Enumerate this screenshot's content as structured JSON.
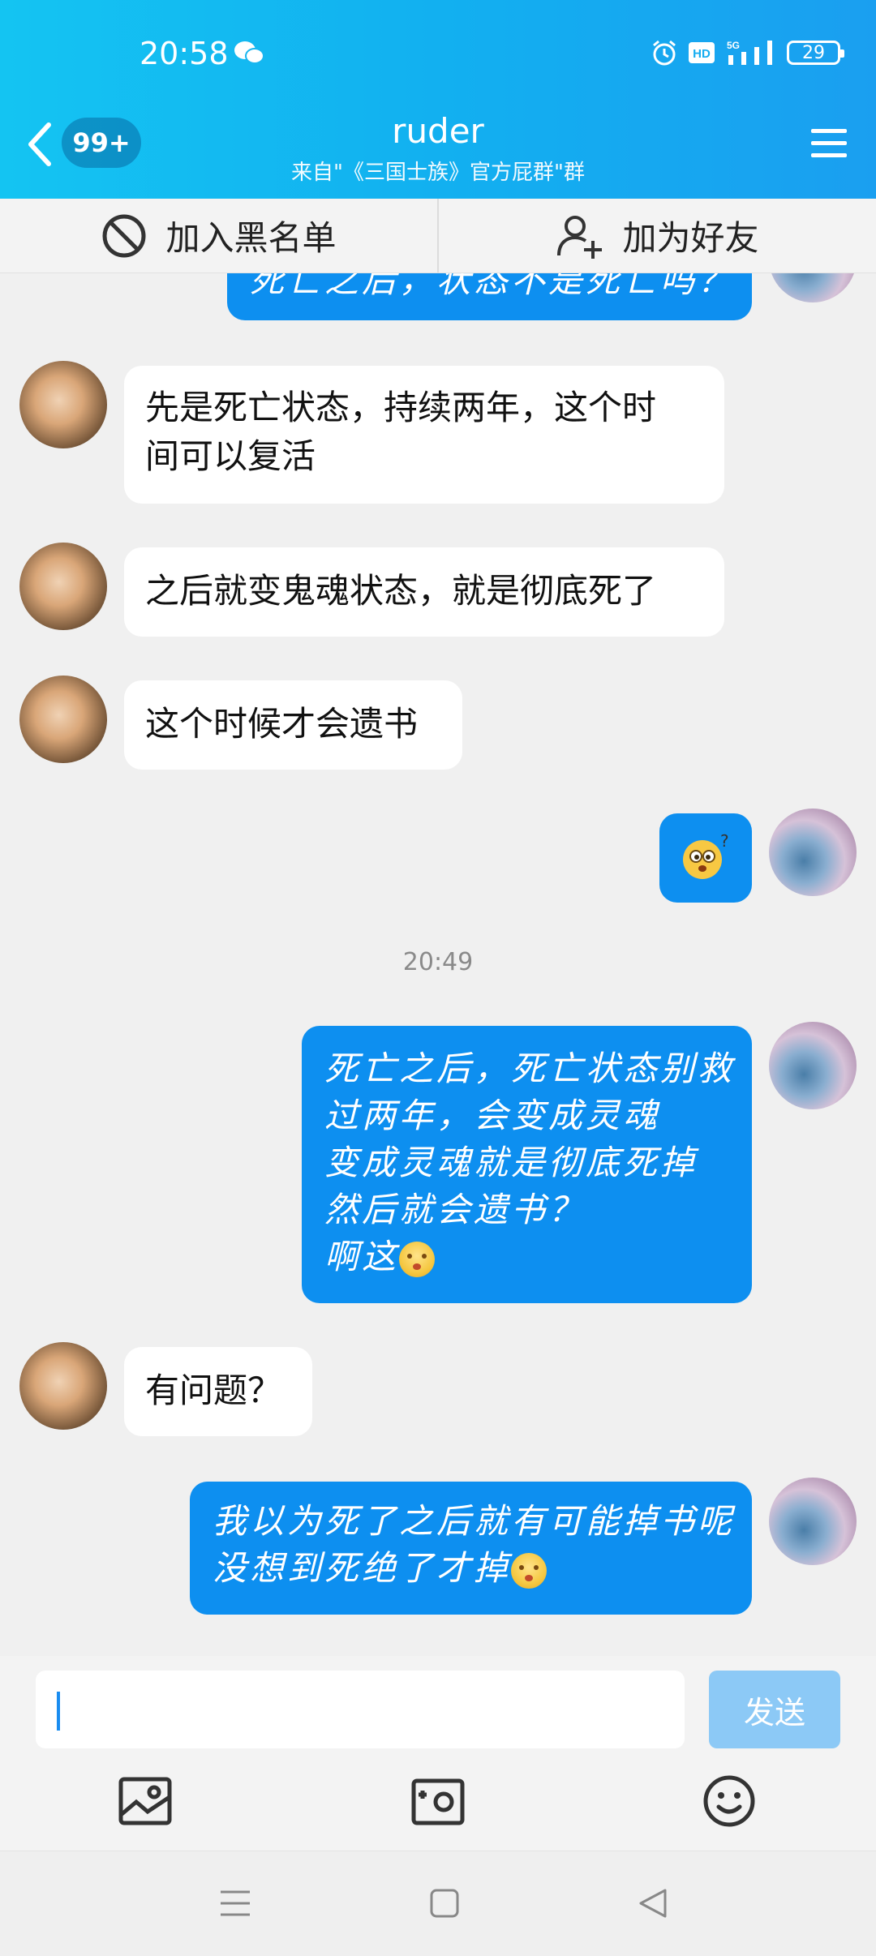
{
  "status": {
    "time": "20:58",
    "battery": "29",
    "network": "5G"
  },
  "header": {
    "back_badge": "99+",
    "title": "ruder",
    "subtitle": "来自\"《三国士族》官方屁群\"群"
  },
  "actions": {
    "block_label": "加入黑名单",
    "add_friend_label": "加为好友"
  },
  "messages": {
    "partial_out": "死亡之后，状态不是死亡吗？",
    "in1_line1": "先是死亡状态，持续两年，这个时",
    "in1_line2": "间可以复活",
    "in2": "之后就变鬼魂状态，就是彻底死了",
    "in3": "这个时候才会遗书",
    "timestamp": "20:49",
    "out2_line1": "死亡之后，死亡状态别救",
    "out2_line2": "过两年，会变成灵魂",
    "out2_line3": "变成灵魂就是彻底死掉",
    "out2_line4": "然后就会遗书？",
    "out2_line5": "啊这",
    "in4": "有问题？",
    "out3_line1": "我以为死了之后就有可能掉书呢",
    "out3_line2": "没想到死绝了才掉"
  },
  "input": {
    "value": "",
    "send_label": "发送"
  },
  "colors": {
    "header_start": "#14c4f2",
    "header_end": "#1a9ff0",
    "bubble_out": "#0d8ff0",
    "send_disabled": "#8cc9f6"
  }
}
